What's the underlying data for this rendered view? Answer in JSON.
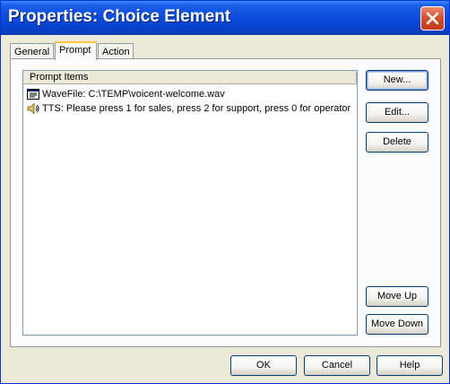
{
  "window": {
    "title": "Properties: Choice Element"
  },
  "tabs": [
    {
      "label": "General"
    },
    {
      "label": "Prompt"
    },
    {
      "label": "Action"
    }
  ],
  "prompt_list": {
    "header": "Prompt Items",
    "items": [
      {
        "icon": "wavefile-icon",
        "text": "WaveFile: C:\\TEMP\\voicent-welcome.wav"
      },
      {
        "icon": "speaker-icon",
        "text": "TTS: Please press 1 for sales, press 2 for support, press 0 for operator"
      }
    ]
  },
  "side_buttons": {
    "new": "New...",
    "edit": "Edit...",
    "delete": "Delete",
    "move_up": "Move Up",
    "move_down": "Move Down"
  },
  "footer_buttons": {
    "ok": "OK",
    "cancel": "Cancel",
    "help": "Help"
  },
  "colors": {
    "titlebar": "#0A4BDB",
    "dialog_bg": "#ECE9D8",
    "active_tab_accent": "#FFC83C",
    "close_button": "#D2502C"
  }
}
